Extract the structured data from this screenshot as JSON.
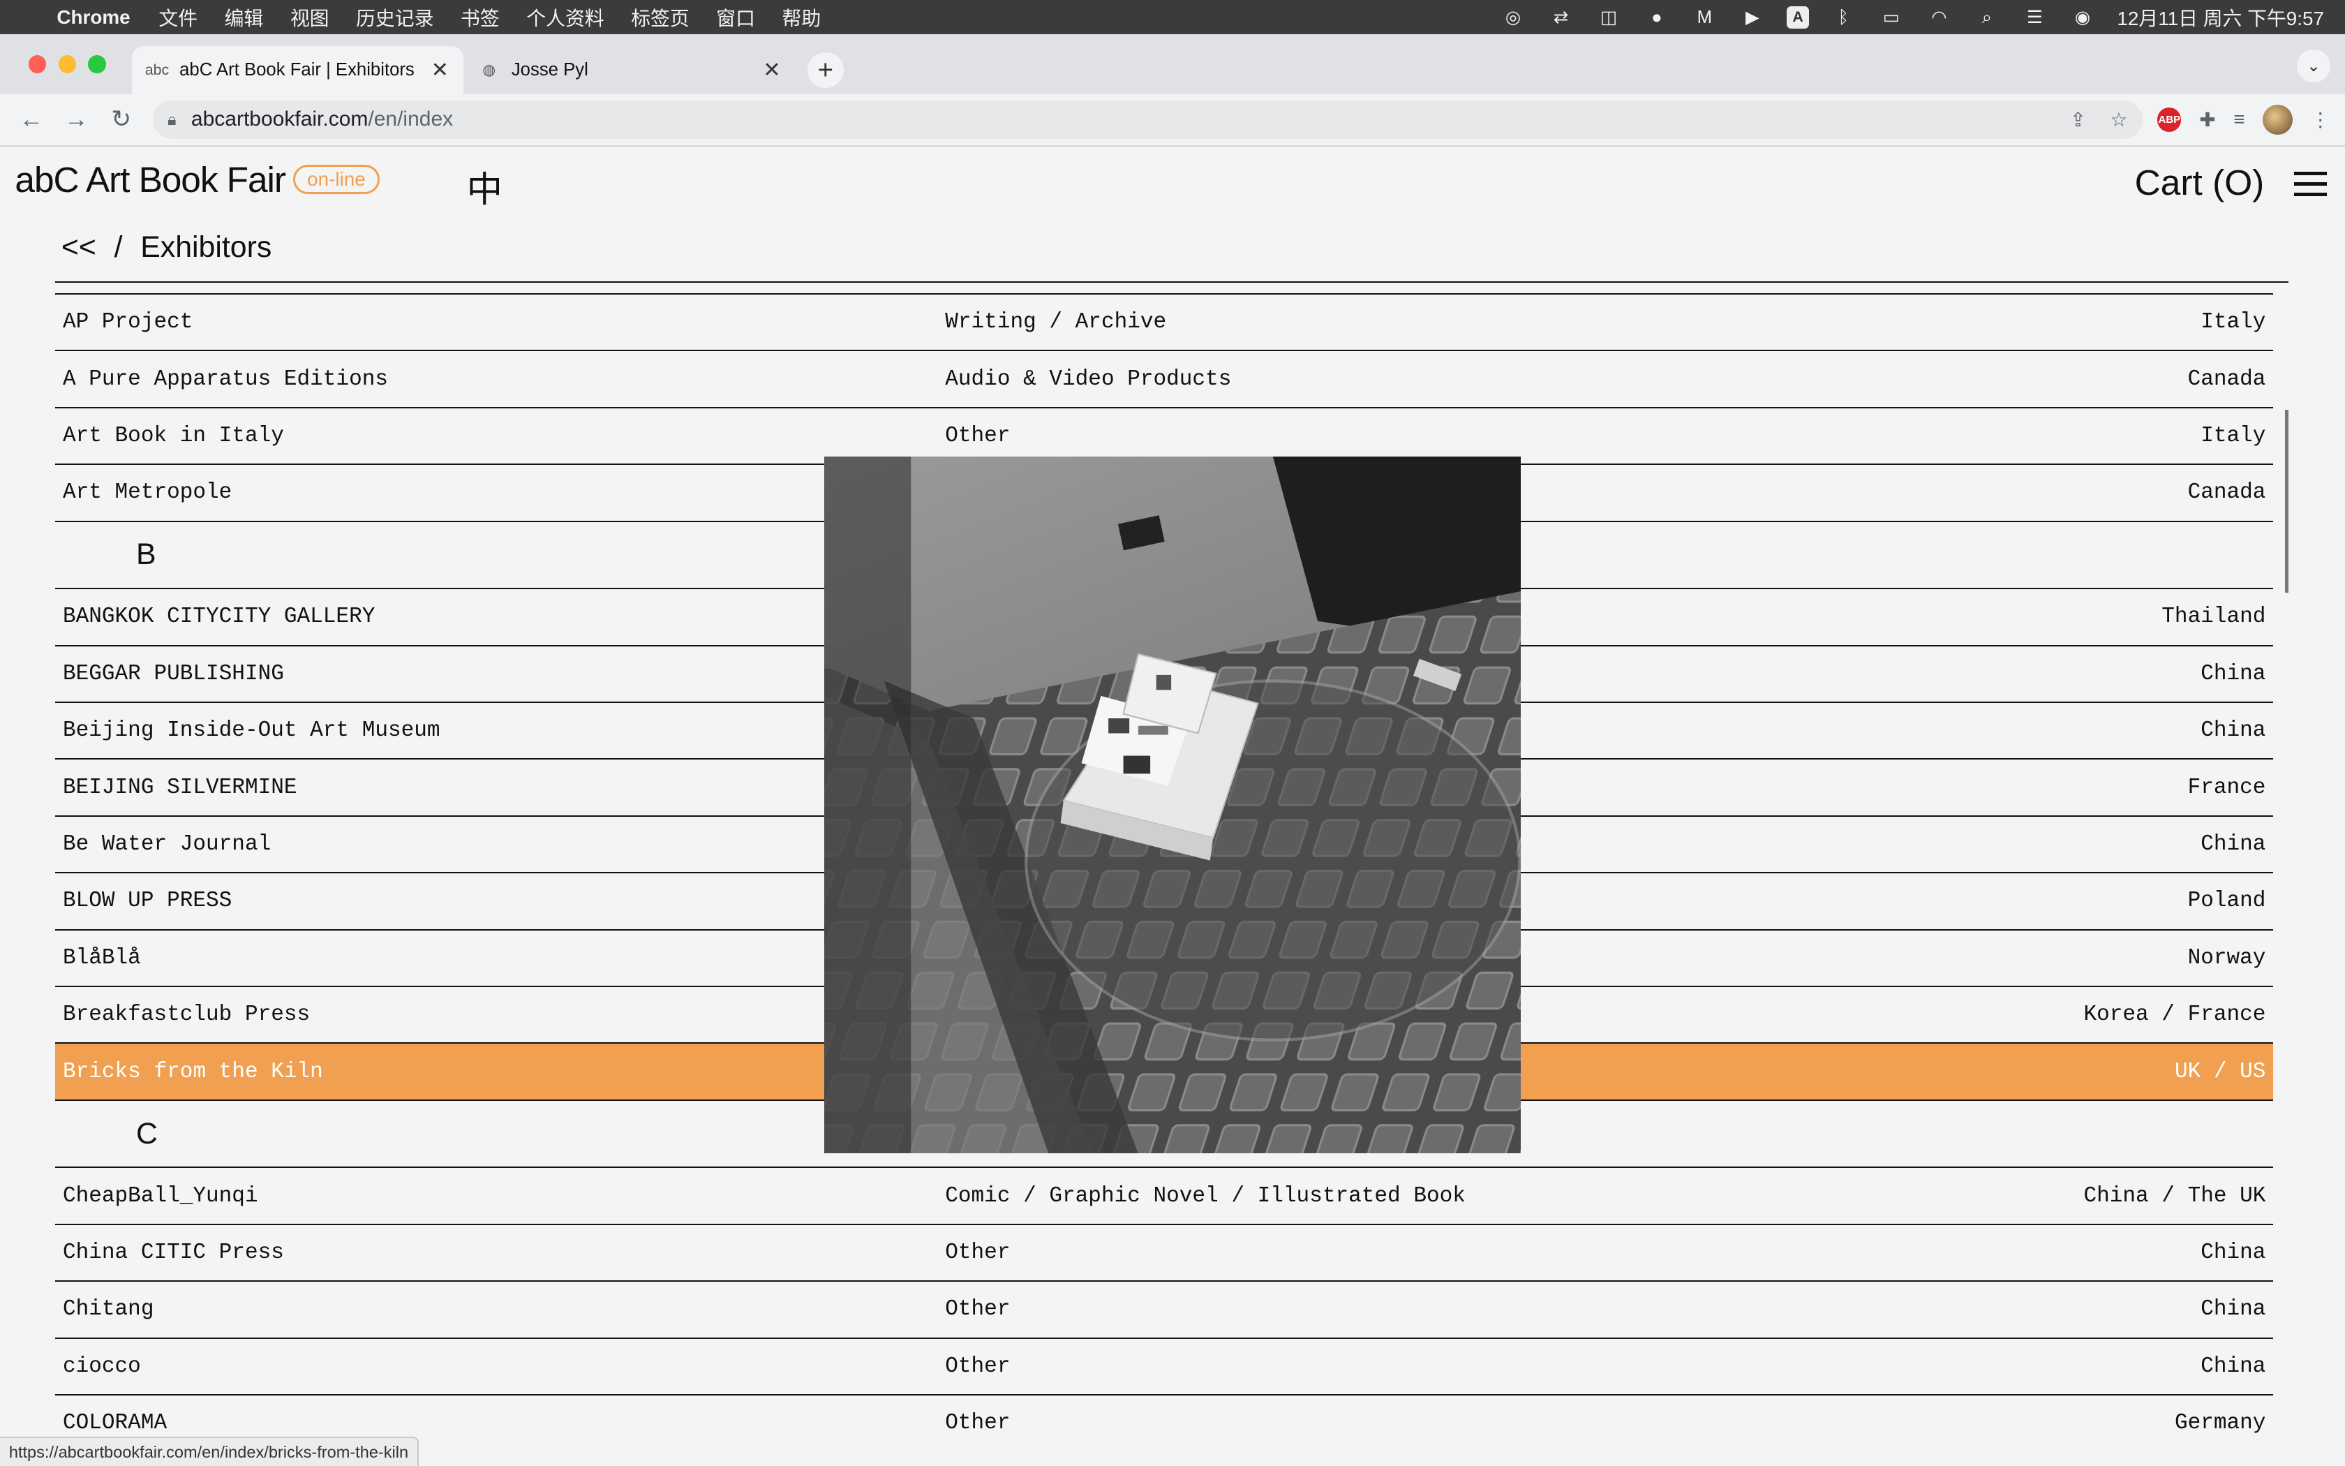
{
  "menubar": {
    "app": "Chrome",
    "items": [
      "文件",
      "编辑",
      "视图",
      "历史记录",
      "书签",
      "个人资料",
      "标签页",
      "窗口",
      "帮助"
    ],
    "datetime": "12月11日 周六 下午9:57",
    "input_badge": "A"
  },
  "browser": {
    "tabs": [
      {
        "title": "abC Art Book Fair | Exhibitors",
        "favicon": "abc"
      },
      {
        "title": "Josse Pyl"
      }
    ],
    "url_domain": "abcartbookfair.com",
    "url_path": "/en/index",
    "abp_label": "ABP",
    "status_url": "https://abcartbookfair.com/en/index/bricks-from-the-kiln"
  },
  "site": {
    "logo": "abC Art Book Fair",
    "badge": "on-line",
    "lang": "中",
    "cart": "Cart (O)"
  },
  "breadcrumb": {
    "back": "<<",
    "sep": "/",
    "title": "Exhibitors"
  },
  "rows": [
    {
      "name": "AP Project",
      "category": "Writing / Archive",
      "country": "Italy"
    },
    {
      "name": "A Pure Apparatus Editions",
      "category": "Audio & Video Products",
      "country": "Canada"
    },
    {
      "name": "Art Book in Italy",
      "category": "Other",
      "country": "Italy"
    },
    {
      "name": "Art Metropole",
      "category": "",
      "country": "Canada"
    },
    {
      "name": "BANGKOK CITYCITY GALLERY",
      "category": "",
      "country": "Thailand"
    },
    {
      "name": "BEGGAR PUBLISHING",
      "category": "",
      "country": "China"
    },
    {
      "name": "Beijing Inside-Out Art Museum",
      "category": "",
      "country": "China"
    },
    {
      "name": "BEIJING SILVERMINE",
      "category": "",
      "country": "France"
    },
    {
      "name": "Be Water Journal",
      "category": "",
      "country": "China"
    },
    {
      "name": "BLOW UP PRESS",
      "category": "",
      "country": "Poland"
    },
    {
      "name": "BlåBlå",
      "category": "",
      "country": "Norway"
    },
    {
      "name": "Breakfastclub Press",
      "category": "",
      "country": "Korea / France"
    },
    {
      "name": "Bricks from the Kiln",
      "category": "",
      "country": "UK / US"
    },
    {
      "name": "CheapBall_Yunqi",
      "category": "Comic / Graphic Novel / Illustrated Book",
      "country": "China / The UK"
    },
    {
      "name": "China CITIC Press",
      "category": "Other",
      "country": "China"
    },
    {
      "name": "Chitang",
      "category": "Other",
      "country": "China"
    },
    {
      "name": "ciocco",
      "category": "Other",
      "country": "China"
    },
    {
      "name": "COLORAMA",
      "category": "Other",
      "country": "Germany"
    }
  ],
  "letters": {
    "b": "B",
    "c": "C"
  },
  "colors": {
    "accent": "#f0a050"
  }
}
